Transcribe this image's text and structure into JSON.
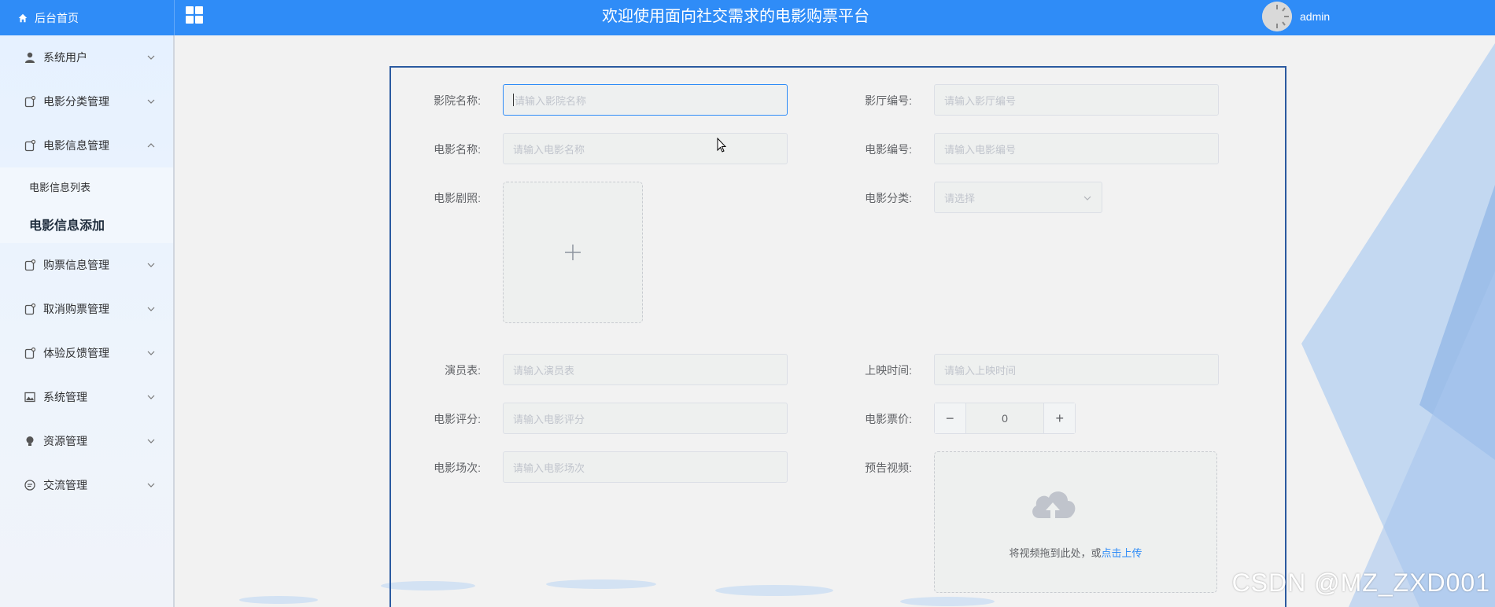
{
  "header": {
    "home_label": "后台首页",
    "title": "欢迎使用面向社交需求的电影购票平台",
    "username": "admin"
  },
  "sidebar": {
    "items": [
      {
        "label": "系统用户",
        "icon": "user-icon",
        "expanded": false
      },
      {
        "label": "电影分类管理",
        "icon": "doc-icon",
        "expanded": false
      },
      {
        "label": "电影信息管理",
        "icon": "doc-icon",
        "expanded": true
      },
      {
        "label": "购票信息管理",
        "icon": "doc-icon",
        "expanded": false
      },
      {
        "label": "取消购票管理",
        "icon": "doc-icon",
        "expanded": false
      },
      {
        "label": "体验反馈管理",
        "icon": "doc-icon",
        "expanded": false
      },
      {
        "label": "系统管理",
        "icon": "image-icon",
        "expanded": false
      },
      {
        "label": "资源管理",
        "icon": "bulb-icon",
        "expanded": false
      },
      {
        "label": "交流管理",
        "icon": "chat-icon",
        "expanded": false
      }
    ],
    "sub_items": [
      {
        "label": "电影信息列表",
        "active": false
      },
      {
        "label": "电影信息添加",
        "active": true
      }
    ]
  },
  "form": {
    "cinema_name": {
      "label": "影院名称:",
      "placeholder": "请输入影院名称"
    },
    "hall_no": {
      "label": "影厅编号:",
      "placeholder": "请输入影厅编号"
    },
    "movie_name": {
      "label": "电影名称:",
      "placeholder": "请输入电影名称"
    },
    "movie_no": {
      "label": "电影编号:",
      "placeholder": "请输入电影编号"
    },
    "poster": {
      "label": "电影剧照:"
    },
    "category": {
      "label": "电影分类:",
      "placeholder": "请选择"
    },
    "cast": {
      "label": "演员表:",
      "placeholder": "请输入演员表"
    },
    "release_time": {
      "label": "上映时间:",
      "placeholder": "请输入上映时间"
    },
    "rating": {
      "label": "电影评分:",
      "placeholder": "请输入电影评分"
    },
    "price": {
      "label": "电影票价:",
      "value": "0"
    },
    "showing": {
      "label": "电影场次:",
      "placeholder": "请输入电影场次"
    },
    "trailer": {
      "label": "预告视频:",
      "hint": "将视频拖到此处，或",
      "link": "点击上传"
    }
  },
  "watermark": "CSDN @MZ_ZXD001",
  "colors": {
    "header": "#2f8cf7",
    "form_border": "#2b5aa0",
    "link": "#2f8cf7"
  }
}
